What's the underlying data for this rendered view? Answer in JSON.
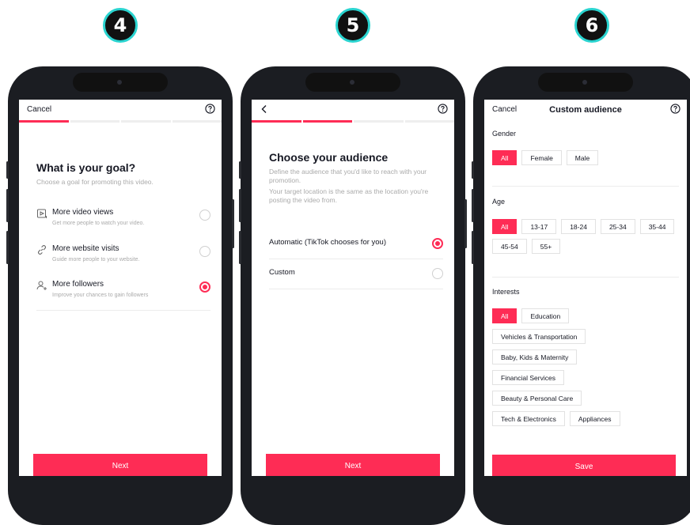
{
  "steps": [
    "4",
    "5",
    "6"
  ],
  "screen1": {
    "cancel": "Cancel",
    "title": "What is your goal?",
    "subtitle": "Choose a goal for promoting this video.",
    "options": [
      {
        "label": "More video views",
        "sub": "Get more people to watch your video.",
        "icon": "video-views-icon",
        "selected": false
      },
      {
        "label": "More website visits",
        "sub": "Guide more people to your website.",
        "icon": "link-icon",
        "selected": false
      },
      {
        "label": "More followers",
        "sub": "Improve your chances to gain followers",
        "icon": "add-user-icon",
        "selected": true
      }
    ],
    "next": "Next"
  },
  "screen2": {
    "title": "Choose your audience",
    "desc1": "Define the audience that you'd like to reach with your promotion.",
    "desc2": "Your target location is the same as the location you're posting the video from.",
    "options": [
      {
        "label": "Automatic (TikTok chooses for you)",
        "selected": true
      },
      {
        "label": "Custom",
        "selected": false
      }
    ],
    "next": "Next"
  },
  "screen3": {
    "cancel": "Cancel",
    "title": "Custom audience",
    "gender_label": "Gender",
    "gender": [
      "All",
      "Female",
      "Male"
    ],
    "age_label": "Age",
    "age": [
      "All",
      "13-17",
      "18-24",
      "25-34",
      "35-44",
      "45-54",
      "55+"
    ],
    "interests_label": "Interests",
    "interests": [
      "All",
      "Education",
      "Vehicles & Transportation",
      "Baby, Kids & Maternity",
      "Financial Services",
      "Beauty & Personal Care",
      "Tech & Electronics",
      "Appliances"
    ],
    "save": "Save"
  },
  "colors": {
    "accent": "#fe2c55",
    "badge_ring": "#2ad4d0",
    "phone": "#1b1d22"
  }
}
